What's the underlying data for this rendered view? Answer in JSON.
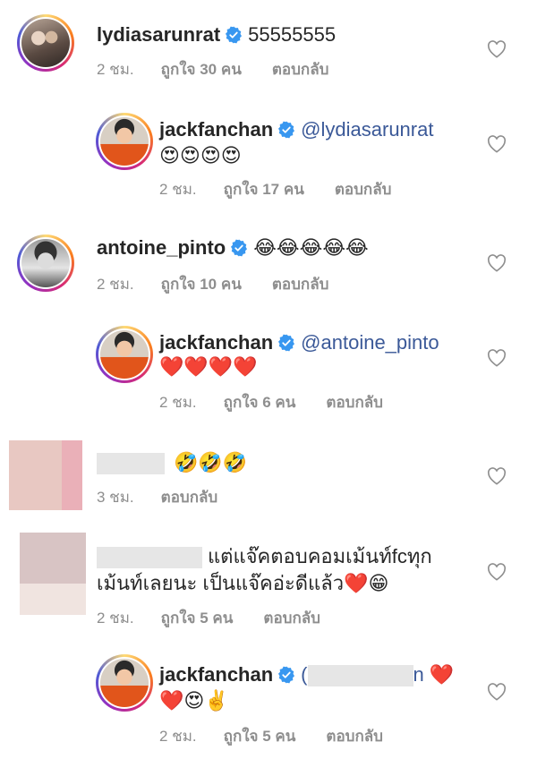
{
  "comments": [
    {
      "username": "lydiasarunrat",
      "text": "55555555",
      "time": "2 ชม.",
      "likes": "ถูกใจ 30 คน",
      "reply": "ตอบกลับ"
    },
    {
      "username": "jackfanchan",
      "mention": "@lydiasarunrat",
      "text": "😍😍😍😍",
      "time": "2 ชม.",
      "likes": "ถูกใจ 17 คน",
      "reply": "ตอบกลับ"
    },
    {
      "username": "antoine_pinto",
      "text": "😂😂😂😂😂",
      "time": "2 ชม.",
      "likes": "ถูกใจ 10 คน",
      "reply": "ตอบกลับ"
    },
    {
      "username": "jackfanchan",
      "mention": "@antoine_pinto",
      "text": "❤️❤️❤️❤️",
      "time": "2 ชม.",
      "likes": "ถูกใจ 6 คน",
      "reply": "ตอบกลับ"
    },
    {
      "username": "",
      "text": "🤣🤣🤣",
      "time": "3 ชม.",
      "reply": "ตอบกลับ"
    },
    {
      "username": "",
      "text_line1": "แต่แจ๊คตอบคอมเม้นท์fcทุก",
      "text_line2": "เม้นท์เลยนะ เป็นแจ๊คอ่ะดีแล้ว❤️😁",
      "time": "2 ชม.",
      "likes": "ถูกใจ 5 คน",
      "reply": "ตอบกลับ"
    },
    {
      "username": "jackfanchan",
      "mention_prefix": "(",
      "mention_suffix": "n",
      "text": "❤️",
      "text_line2": "❤️😍✌️",
      "time": "2 ชม.",
      "likes": "ถูกใจ 5 คน",
      "reply": "ตอบกลับ"
    }
  ],
  "colors": {
    "verified": "#3897f0",
    "mention": "#3b5998",
    "meta": "#8e8e8e",
    "heart_outline": "#8e8e8e"
  },
  "icons": {
    "verified": "verified-badge-icon",
    "like": "heart-outline-icon"
  }
}
